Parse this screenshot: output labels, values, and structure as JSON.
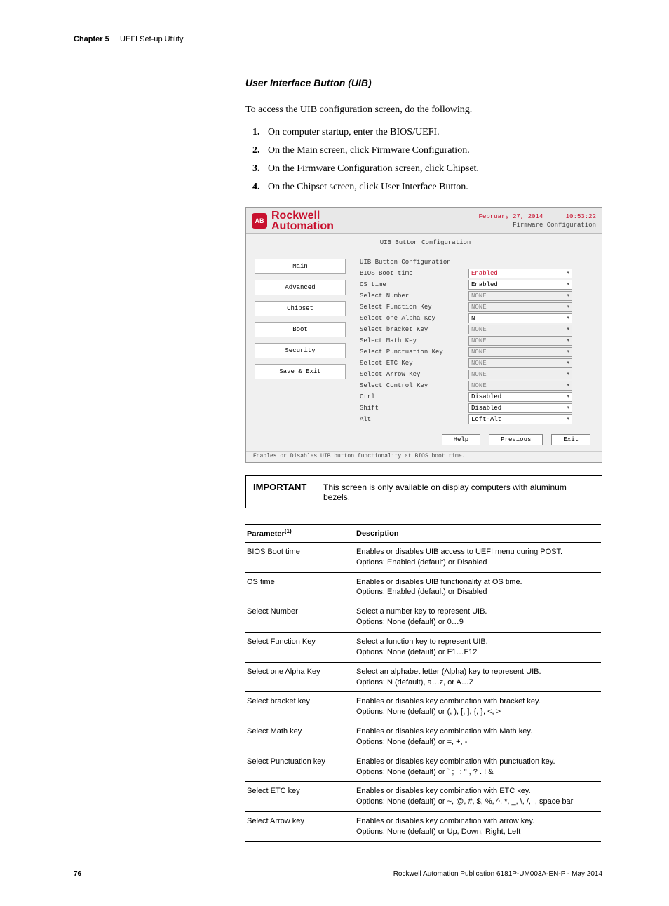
{
  "header": {
    "chapter": "Chapter 5",
    "title": "UEFI Set-up Utility"
  },
  "section": {
    "subheading": "User Interface Button (UIB)",
    "intro": "To access the UIB configuration screen, do the following.",
    "steps": [
      "On computer startup, enter the BIOS/UEFI.",
      "On the Main screen, click Firmware Configuration.",
      "On the Firmware Configuration screen, click Chipset.",
      "On the Chipset screen, click User Interface Button."
    ]
  },
  "bios": {
    "brand1": "Rockwell",
    "brand2": "Automation",
    "date": "February 27, 2014",
    "time": "10:53:22",
    "fw": "Firmware Configuration",
    "nav": [
      "Main",
      "Advanced",
      "Chipset",
      "Boot",
      "Security",
      "Save & Exit"
    ],
    "screen_title": "UIB Button Configuration",
    "section_label": "UIB Button Configuration",
    "rows": [
      {
        "label": "BIOS Boot time",
        "val": "Enabled",
        "style": "red"
      },
      {
        "label": "OS time",
        "val": "Enabled",
        "style": "norm"
      },
      {
        "label": "Select Number",
        "val": "NONE",
        "style": "grey",
        "disabled": true
      },
      {
        "label": "Select Function Key",
        "val": "NONE",
        "style": "grey",
        "disabled": true
      },
      {
        "label": "Select one Alpha Key",
        "val": "N",
        "style": "norm"
      },
      {
        "label": "Select bracket Key",
        "val": "NONE",
        "style": "grey",
        "disabled": true
      },
      {
        "label": "Select Math Key",
        "val": "NONE",
        "style": "grey",
        "disabled": true
      },
      {
        "label": "Select Punctuation Key",
        "val": "NONE",
        "style": "grey",
        "disabled": true
      },
      {
        "label": "Select ETC Key",
        "val": "NONE",
        "style": "grey",
        "disabled": true
      },
      {
        "label": "Select Arrow Key",
        "val": "NONE",
        "style": "grey",
        "disabled": true
      },
      {
        "label": "Select Control Key",
        "val": "NONE",
        "style": "grey",
        "disabled": true
      },
      {
        "label": "Ctrl",
        "val": "Disabled",
        "style": "norm"
      },
      {
        "label": "Shift",
        "val": "Disabled",
        "style": "norm"
      },
      {
        "label": "Alt",
        "val": "Left-Alt",
        "style": "norm"
      }
    ],
    "buttons": [
      "Help",
      "Previous",
      "Exit"
    ],
    "note": "Enables or Disables UIB button functionality at BIOS boot time."
  },
  "important": {
    "label": "IMPORTANT",
    "text": "This screen is only available on display computers with aluminum bezels."
  },
  "table": {
    "headers": {
      "param": "Parameter",
      "paramsup": "(1)",
      "desc": "Description"
    },
    "rows": [
      {
        "p": "BIOS Boot time",
        "d": "Enables or disables UIB access to UEFI menu during POST.\nOptions: Enabled (default) or Disabled"
      },
      {
        "p": "OS time",
        "d": "Enables or disables UIB functionality at OS time.\nOptions: Enabled (default) or Disabled"
      },
      {
        "p": "Select Number",
        "d": "Select a number key to represent UIB.\nOptions: None (default) or 0…9"
      },
      {
        "p": "Select Function Key",
        "d": "Select a function key to represent UIB.\nOptions: None (default) or F1…F12"
      },
      {
        "p": "Select one Alpha Key",
        "d": "Select an alphabet letter (Alpha) key to represent UIB.\nOptions: N (default), a…z, or A…Z"
      },
      {
        "p": "Select bracket key",
        "d": "Enables or disables key combination with bracket key.\nOptions: None (default) or (, ), [, ], {, }, <, >"
      },
      {
        "p": "Select Math key",
        "d": "Enables or disables key combination with Math key.\nOptions: None (default) or =, +, -"
      },
      {
        "p": "Select Punctuation key",
        "d": "Enables or disables key combination with punctuation key.\nOptions: None (default) or ` ; ' : \" , ? . ! &"
      },
      {
        "p": "Select ETC key",
        "d": "Enables or disables key combination with ETC key.\nOptions: None (default) or ~, @, #, $, %, ^, *, _, \\, /, |, space bar"
      },
      {
        "p": "Select Arrow key",
        "d": "Enables or disables key combination with arrow key.\nOptions: None (default) or Up, Down, Right, Left"
      }
    ]
  },
  "footer": {
    "page": "76",
    "pub": "Rockwell Automation Publication 6181P-UM003A-EN-P - May 2014"
  }
}
